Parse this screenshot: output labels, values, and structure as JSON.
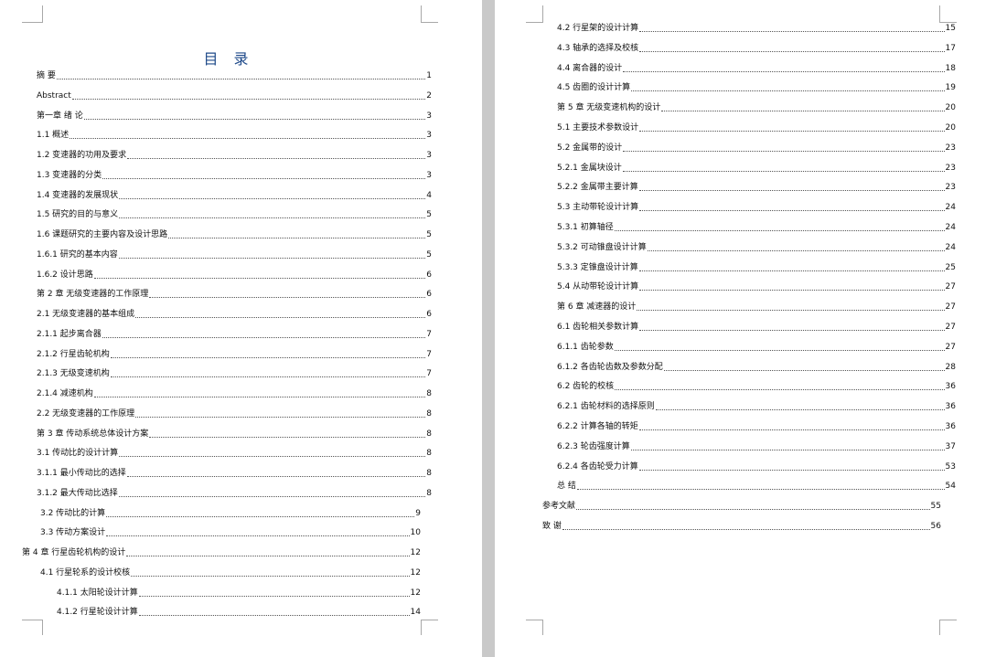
{
  "toc": {
    "title": "目 录",
    "left_entries": [
      {
        "label": "摘 要",
        "page": "1"
      },
      {
        "label": "Abstract",
        "page": "2"
      },
      {
        "label": "第一章 绪 论",
        "page": "3"
      },
      {
        "label": "1.1 概述",
        "page": "3"
      },
      {
        "label": "1.2 变速器的功用及要求",
        "page": "3"
      },
      {
        "label": "1.3 变速器的分类",
        "page": "3"
      },
      {
        "label": "1.4 变速器的发展现状",
        "page": "4"
      },
      {
        "label": "1.5 研究的目的与意义",
        "page": "5"
      },
      {
        "label": "1.6 课题研究的主要内容及设计思路",
        "page": "5"
      },
      {
        "label": "1.6.1 研究的基本内容",
        "page": "5"
      },
      {
        "label": "1.6.2 设计思路",
        "page": "6"
      },
      {
        "label": "第 2 章 无级变速器的工作原理",
        "page": "6"
      },
      {
        "label": "2.1 无级变速器的基本组成",
        "page": "6"
      },
      {
        "label": "2.1.1 起步离合器",
        "page": "7"
      },
      {
        "label": "2.1.2 行星齿轮机构",
        "page": "7"
      },
      {
        "label": "2.1.3 无级变速机构",
        "page": "7"
      },
      {
        "label": "2.1.4 减速机构",
        "page": "8"
      },
      {
        "label": "2.2 无级变速器的工作原理",
        "page": "8"
      },
      {
        "label": "第 3 章 传动系统总体设计方案",
        "page": "8"
      },
      {
        "label": "3.1 传动比的设计计算",
        "page": "8"
      },
      {
        "label": "3.1.1 最小传动比的选择",
        "page": "8"
      },
      {
        "label": "3.1.2 最大传动比选择",
        "page": "8"
      },
      {
        "label": "3.2 传动比的计算",
        "page": "9"
      },
      {
        "label": "3.3 传动方案设计",
        "page": "10"
      },
      {
        "label": "第 4 章 行星齿轮机构的设计",
        "page": "12"
      },
      {
        "label": "4.1 行星轮系的设计校核",
        "page": "12"
      },
      {
        "label": "4.1.1 太阳轮设计计算",
        "page": "12"
      },
      {
        "label": "4.1.2 行星轮设计计算",
        "page": "14"
      }
    ],
    "right_entries": [
      {
        "label": "4.2 行星架的设计计算",
        "page": "15"
      },
      {
        "label": "4.3 轴承的选择及校核",
        "page": "17"
      },
      {
        "label": "4.4 离合器的设计",
        "page": "18"
      },
      {
        "label": "4.5 齿圈的设计计算",
        "page": "19"
      },
      {
        "label": "第 5 章 无级变速机构的设计",
        "page": "20"
      },
      {
        "label": "5.1 主要技术参数设计",
        "page": "20"
      },
      {
        "label": "5.2 金属带的设计",
        "page": "23"
      },
      {
        "label": "5.2.1 金属块设计",
        "page": "23"
      },
      {
        "label": "5.2.2 金属带主要计算",
        "page": "23"
      },
      {
        "label": "5.3 主动带轮设计计算",
        "page": "24"
      },
      {
        "label": "5.3.1 初算轴径",
        "page": "24"
      },
      {
        "label": "5.3.2 可动锥盘设计计算",
        "page": "24"
      },
      {
        "label": "5.3.3 定锥盘设计计算",
        "page": "25"
      },
      {
        "label": "5.4 从动带轮设计计算",
        "page": "27"
      },
      {
        "label": "第 6 章 减速器的设计",
        "page": "27"
      },
      {
        "label": "6.1 齿轮相关参数计算",
        "page": "27"
      },
      {
        "label": "6.1.1 齿轮参数",
        "page": "27"
      },
      {
        "label": "6.1.2 各齿轮齿数及参数分配",
        "page": "28"
      },
      {
        "label": "6.2 齿轮的校核",
        "page": "36"
      },
      {
        "label": "6.2.1 齿轮材料的选择原则",
        "page": "36"
      },
      {
        "label": "6.2.2 计算各轴的转矩",
        "page": "36"
      },
      {
        "label": "6.2.3 轮齿强度计算",
        "page": "37"
      },
      {
        "label": "6.2.4 各齿轮受力计算",
        "page": "53"
      },
      {
        "label": "总 结",
        "page": "54"
      },
      {
        "label": "参考文献",
        "page": "55"
      },
      {
        "label": "致 谢",
        "page": "56"
      }
    ]
  }
}
